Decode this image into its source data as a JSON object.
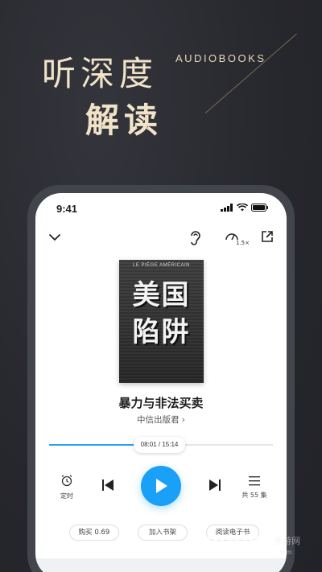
{
  "hero": {
    "line1": "听深度",
    "line2": "解读",
    "english": "AUDIOBOOKS"
  },
  "status_bar": {
    "time": "9:41"
  },
  "topbar": {
    "collapse_icon": "chevron-down-icon",
    "ear_icon": "ear-icon",
    "speed_label": "1.5×",
    "share_icon": "share-icon"
  },
  "book": {
    "cover_top": "LE PIÈGE AMÉRICAIN",
    "cover_line1": "美国",
    "cover_line2": "陷阱",
    "title": "暴力与非法买卖",
    "publisher": "中信出版君 ›"
  },
  "progress": {
    "label": "08:01 / 15:14",
    "fraction": 0.53
  },
  "controls": {
    "timer_label": "定时",
    "chapters_label": "共 55 集"
  },
  "actions": {
    "buy": "购买 0.69",
    "add_shelf": "加入书架",
    "read_ebook": "阅读电子书"
  },
  "watermark": {
    "brand": "2265",
    "sub": "手游网",
    "url": ".com"
  },
  "colors": {
    "accent": "#1aa0f7",
    "hero_text": "#f1e3c8",
    "background": "#2a2b31"
  }
}
